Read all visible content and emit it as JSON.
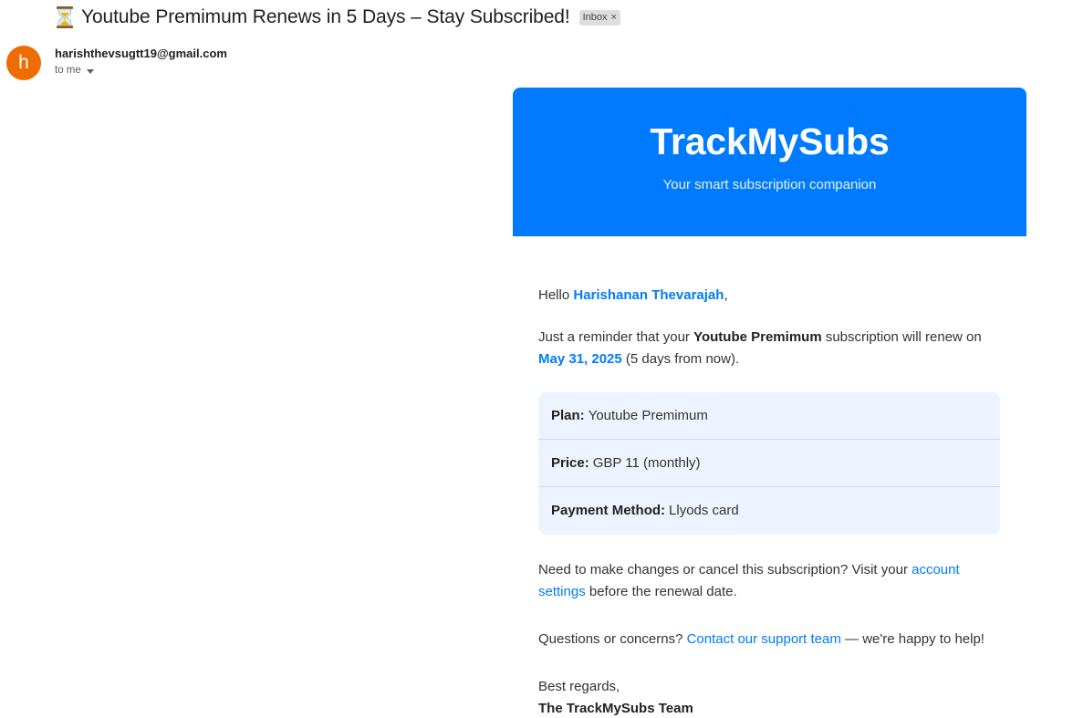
{
  "email": {
    "subject": "Youtube Premimum Renews in 5 Days – Stay Subscribed!",
    "subject_icon": "hourglass-icon",
    "label_chip": "Inbox",
    "label_chip_close": "×",
    "sender": {
      "avatar_letter": "h",
      "avatar_color": "#ef6c00",
      "address": "harishthevsugtt19@gmail.com",
      "recipient_line": "to me"
    }
  },
  "card": {
    "accent_color": "#007bff",
    "brand_title": "TrackMySubs",
    "brand_tagline": "Your smart subscription companion",
    "greeting_prefix": "Hello ",
    "greeting_name": "Harishanan Thevarajah",
    "greeting_suffix": ",",
    "reminder": {
      "prefix": "Just a reminder that your ",
      "service": "Youtube Premimum",
      "middle": " subscription will renew on ",
      "date": "May 31, 2025",
      "suffix": " (5 days from now)."
    },
    "details": [
      {
        "label": "Plan:",
        "value": "Youtube Premimum"
      },
      {
        "label": "Price:",
        "value": "GBP 11 (monthly)"
      },
      {
        "label": "Payment Method:",
        "value": "Llyods card"
      }
    ],
    "changes": {
      "prefix": "Need to make changes or cancel this subscription? Visit your ",
      "link": "account settings",
      "suffix": " before the renewal date."
    },
    "questions": {
      "prefix": "Questions or concerns? ",
      "link": "Contact our support team",
      "suffix": " — we're happy to help!"
    },
    "signoff": "Best regards,",
    "team": "The TrackMySubs Team"
  }
}
